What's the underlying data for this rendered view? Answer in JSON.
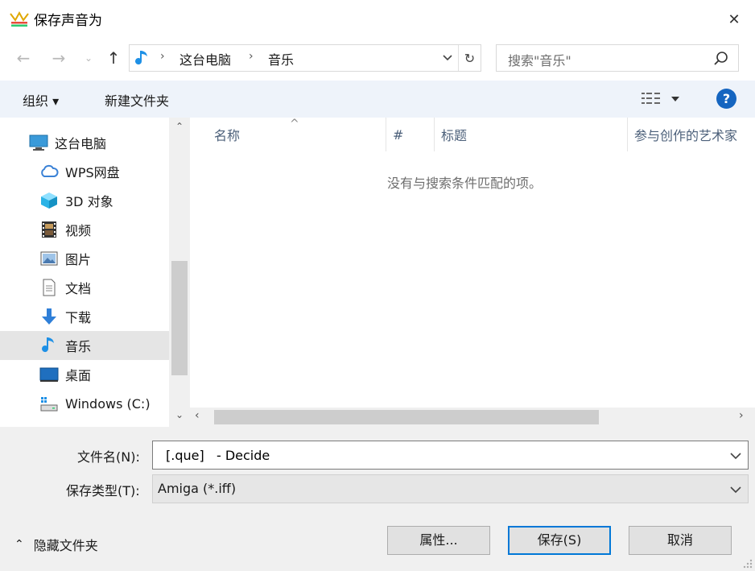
{
  "window": {
    "title": "保存声音为",
    "close_symbol": "✕"
  },
  "address": {
    "back_symbol": "←",
    "forward_symbol": "→",
    "recent_symbol": "⌄",
    "up_symbol": "↑",
    "segments": [
      "这台电脑",
      "音乐"
    ],
    "chevron": "›",
    "refresh_symbol": "↻"
  },
  "search": {
    "placeholder": "搜索\"音乐\""
  },
  "toolbar": {
    "organize_label": "组织 ▾",
    "new_folder_label": "新建文件夹",
    "help_label": "?"
  },
  "nav": {
    "items": [
      {
        "label": "这台电脑",
        "icon": "computer-icon"
      },
      {
        "label": "WPS网盘",
        "icon": "cloud-icon"
      },
      {
        "label": "3D 对象",
        "icon": "cube-icon"
      },
      {
        "label": "视频",
        "icon": "film-icon"
      },
      {
        "label": "图片",
        "icon": "picture-icon"
      },
      {
        "label": "文档",
        "icon": "document-icon"
      },
      {
        "label": "下载",
        "icon": "download-arrow-icon"
      },
      {
        "label": "音乐",
        "icon": "music-note-icon",
        "selected": true
      },
      {
        "label": "桌面",
        "icon": "desktop-icon"
      },
      {
        "label": "Windows (C:)",
        "icon": "drive-icon"
      }
    ],
    "scroll_up": "⌃",
    "scroll_down": "⌄"
  },
  "file_list": {
    "columns": [
      "名称",
      "#",
      "标题",
      "参与创作的艺术家"
    ],
    "sort_indicator": "^",
    "empty_message": "没有与搜索条件匹配的项。",
    "hscroll_left": "‹",
    "hscroll_right": "›"
  },
  "form": {
    "filename_label": "文件名(N):",
    "filename_value": "[.que]   - Decide",
    "filetype_label": "保存类型(T):",
    "filetype_value": "Amiga (*.iff)"
  },
  "footer": {
    "hide_folders_label": "隐藏文件夹",
    "hide_folders_symbol": "⌃",
    "properties_label": "属性...",
    "save_label": "保存(S)",
    "cancel_label": "取消"
  },
  "colors": {
    "accent": "#0078d7",
    "toolbar_bg": "#eef3fa",
    "selected_bg": "#e5e5e5",
    "music_icon": "#1e90e6"
  }
}
